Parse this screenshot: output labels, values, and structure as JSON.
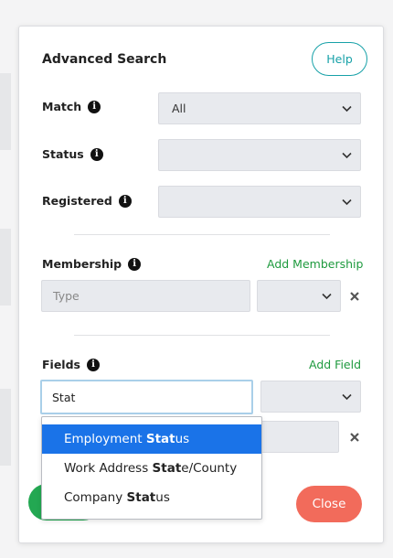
{
  "panel": {
    "title": "Advanced Search",
    "help_label": "Help",
    "close_label": "Close"
  },
  "rows": {
    "match": {
      "label": "Match",
      "value": "All"
    },
    "status": {
      "label": "Status",
      "value": ""
    },
    "registered": {
      "label": "Registered",
      "value": ""
    }
  },
  "membership": {
    "label": "Membership",
    "add_label": "Add Membership",
    "type_placeholder": "Type",
    "second_value": ""
  },
  "fields": {
    "label": "Fields",
    "add_label": "Add Field",
    "input_value": "Stat",
    "second_value": ""
  },
  "suggestions": [
    {
      "prefix": "Employment ",
      "match": "Stat",
      "suffix": "us"
    },
    {
      "prefix": "Work Address ",
      "match": "Stat",
      "suffix": "e/County"
    },
    {
      "prefix": "Company ",
      "match": "Stat",
      "suffix": "us"
    }
  ],
  "colors": {
    "accent_teal": "#17a1a8",
    "link_green": "#1e9a3e",
    "close_red": "#f26b5b",
    "highlight_blue": "#1a73e8"
  },
  "icons": {
    "info": "info-icon",
    "chevron": "chevron-down-icon",
    "remove": "close-icon"
  }
}
